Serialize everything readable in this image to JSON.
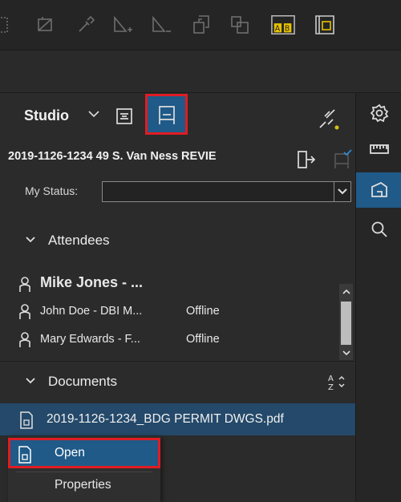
{
  "toolbar": {
    "icons": [
      "select-area-icon",
      "crop-icon",
      "eyedropper-icon",
      "add-vertex-icon",
      "remove-vertex-icon",
      "replace-page-icon",
      "compare-pages-icon",
      "text-compare-icon",
      "page-layout-icon"
    ]
  },
  "studio": {
    "label": "Studio",
    "session_title": "2019-1126-1234 49 S. Van Ness REVIE"
  },
  "status": {
    "label": "My Status:",
    "value": ""
  },
  "attendees": {
    "header": "Attendees",
    "items": [
      {
        "name": "Mike Jones - ...",
        "status": ""
      },
      {
        "name": "John Doe - DBI M...",
        "status": "Offline"
      },
      {
        "name": "Mary Edwards - F...",
        "status": "Offline"
      }
    ]
  },
  "documents": {
    "header": "Documents",
    "items": [
      {
        "name": "2019-1126-1234_BDG PERMIT DWGS.pdf"
      }
    ]
  },
  "context_menu": {
    "open_label": "Open",
    "properties_label": "Properties"
  },
  "colors": {
    "accent": "#1f5a88",
    "highlight": "#e01c24",
    "panel": "#2b2b2b",
    "selected_row": "#24496a"
  }
}
